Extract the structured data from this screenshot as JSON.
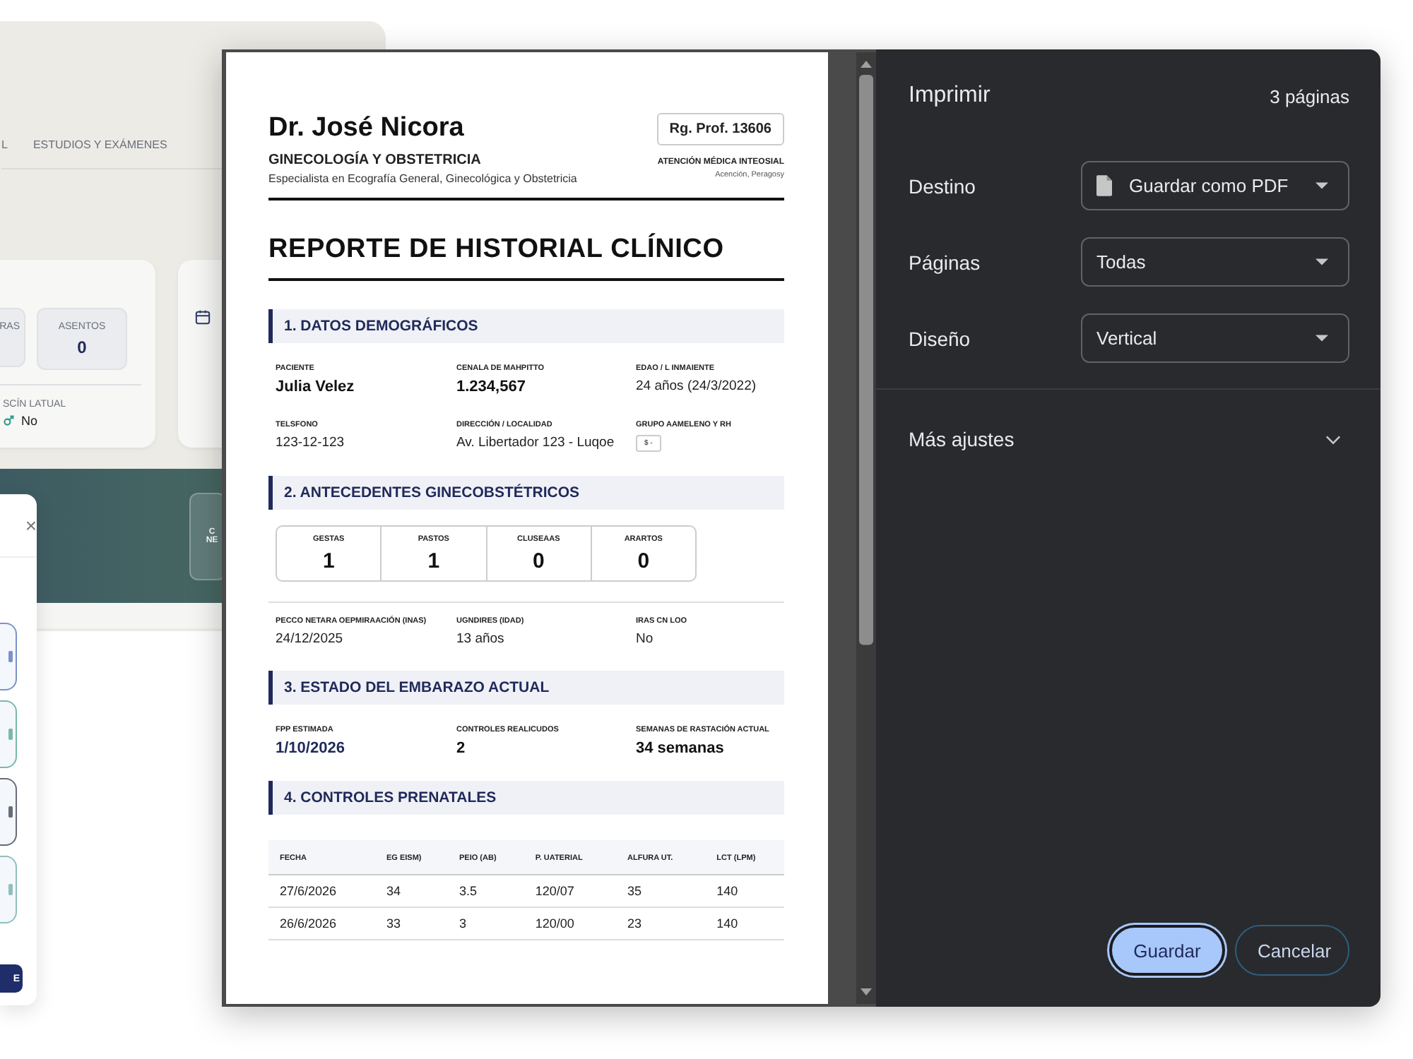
{
  "background_app": {
    "tabs": [
      {
        "label": "L",
        "selected": false
      },
      {
        "label": "ESTUDIOS Y EXÁMENES",
        "selected": false
      }
    ],
    "stats": [
      {
        "label": "RAS"
      },
      {
        "label": "ASENTOS",
        "value": "0"
      }
    ],
    "status_field": {
      "label": "SCÍN LATUAL",
      "value": "No"
    },
    "banner_button": {
      "lines": [
        "C",
        "NE"
      ]
    }
  },
  "side_panel": {
    "close": "×",
    "cards": [
      {
        "color": "#7b93c9"
      },
      {
        "color": "#79b9a8"
      },
      {
        "color": "#666b78"
      },
      {
        "color": "#8fbfbf"
      }
    ],
    "button": "E"
  },
  "print_preview": {
    "header": {
      "name": "Dr. José Nicora",
      "specialty": "GINECOLOGÍA Y OBSTETRICIA",
      "subtitle": "Especialista en Ecografía General, Ginecológica y Obstetricia",
      "registration": "Rg. Prof. 13606",
      "clinic": "ATENCIÓN MÉDICA INTEOSIAL",
      "location": "Acención, Peragosy"
    },
    "title": "REPORTE DE HISTORIAL CLÍNICO",
    "sections": [
      {
        "kind": "fields",
        "heading": "1. DATOS DEMOGRÁFICOS",
        "fields": [
          {
            "label": "PACIENTE",
            "value": "Julia Velez",
            "kind": "strong"
          },
          {
            "label": "CENALA DE MAHPITTO",
            "value": "1.234,567",
            "kind": "strong"
          },
          {
            "label": "EDAO / L INMAIENTE",
            "value": "24 años (24/3/2022)",
            "kind": "plain"
          },
          {
            "label": "TELSFONO",
            "value": "123-12-123",
            "kind": "plain"
          },
          {
            "label": "DIRECCIÓN / LOCALIDAD",
            "value": "Av. Libertador 123 - Luqoe",
            "kind": "plain"
          },
          {
            "label": "GRUPO AAMELENO Y RH",
            "value": "$ -",
            "kind": "tag"
          }
        ]
      },
      {
        "kind": "counts",
        "heading": "2. ANTECEDENTES GINECOBSTÉTRICOS",
        "counts": [
          {
            "label": "GESTAS",
            "value": "1"
          },
          {
            "label": "PASTOS",
            "value": "1"
          },
          {
            "label": "CLUSEAAS",
            "value": "0"
          },
          {
            "label": "ARARTOS",
            "value": "0"
          }
        ],
        "fields": [
          {
            "label": "PECCO NETARA OEPMIRAACIÓN (INAS)",
            "value": "24/12/2025",
            "kind": "plain"
          },
          {
            "label": "UGNDIRES (IDAD)",
            "value": "13 años",
            "kind": "plain"
          },
          {
            "label": "IRAS CN LOO",
            "value": "No",
            "kind": "plain"
          }
        ]
      },
      {
        "kind": "fields",
        "heading": "3. ESTADO DEL EMBARAZO ACTUAL",
        "fields": [
          {
            "label": "FPP ESTIMADA",
            "value": "1/10/2026",
            "kind": "accent"
          },
          {
            "label": "CONTROLES REALICUDOS",
            "value": "2",
            "kind": "strong"
          },
          {
            "label": "SEMANAS DE RASTACIÓN ACTUAL",
            "value": "34 semanas",
            "kind": "strong"
          }
        ]
      },
      {
        "kind": "table",
        "heading": "4. CONTROLES PRENATALES",
        "columns": [
          "FECHA",
          "EG EISM)",
          "PEIO (AB)",
          "P. UATERIAL",
          "ALFURA UT.",
          "LCT (LPM)"
        ],
        "rows": [
          [
            "27/6/2026",
            "34",
            "3.5",
            "120/07",
            "35",
            "140"
          ],
          [
            "26/6/2026",
            "33",
            "3",
            "120/00",
            "23",
            "140"
          ]
        ]
      }
    ]
  },
  "print_settings": {
    "title": "Imprimir",
    "page_count": "3 páginas",
    "settings": [
      {
        "label": "Destino",
        "value": "Guardar como PDF",
        "kind": "document"
      },
      {
        "label": "Páginas",
        "value": "Todas",
        "kind": "plain"
      },
      {
        "label": "Diseño",
        "value": "Vertical",
        "kind": "plain"
      }
    ],
    "more": {
      "label": "Más ajustes",
      "expanded": false
    },
    "buttons": [
      {
        "label": "Guardar",
        "kind": "primary"
      },
      {
        "label": "Cancelar",
        "kind": "secondary"
      }
    ]
  }
}
